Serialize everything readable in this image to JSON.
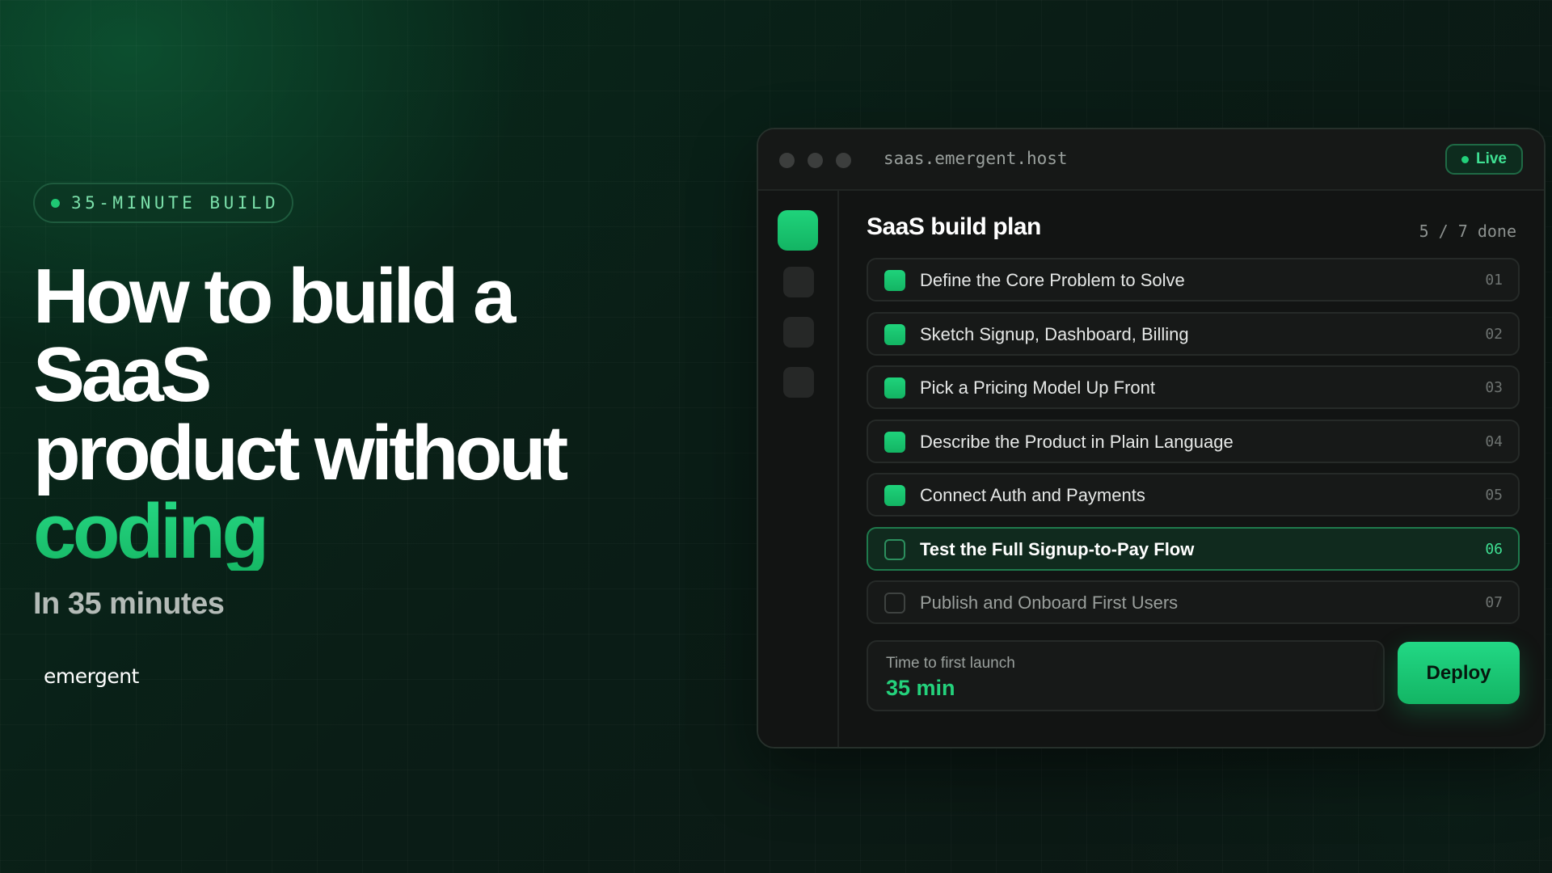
{
  "hero": {
    "badge": "35-MINUTE BUILD",
    "headline_lines": [
      "How to build a",
      "SaaS",
      "product without"
    ],
    "headline_accent": "coding",
    "subtitle": "In 35 minutes",
    "brand": "emergent"
  },
  "window": {
    "url": "saas.emergent.host",
    "status": "Live",
    "plan": {
      "title": "SaaS build plan",
      "progress": "5 / 7 done",
      "tasks": [
        {
          "label": "Define the Core Problem to Solve",
          "num": "01",
          "state": "done"
        },
        {
          "label": "Sketch Signup, Dashboard, Billing",
          "num": "02",
          "state": "done"
        },
        {
          "label": "Pick a Pricing Model Up Front",
          "num": "03",
          "state": "done"
        },
        {
          "label": "Describe the Product in Plain Language",
          "num": "04",
          "state": "done"
        },
        {
          "label": "Connect Auth and Payments",
          "num": "05",
          "state": "done"
        },
        {
          "label": "Test the Full Signup-to-Pay Flow",
          "num": "06",
          "state": "current"
        },
        {
          "label": "Publish and Onboard First Users",
          "num": "07",
          "state": "pending"
        }
      ]
    },
    "launch": {
      "label": "Time to first launch",
      "value": "35 min"
    },
    "deploy_label": "Deploy"
  },
  "colors": {
    "accent": "#1fc873",
    "background": "#0a1d16",
    "window": "#121413"
  }
}
